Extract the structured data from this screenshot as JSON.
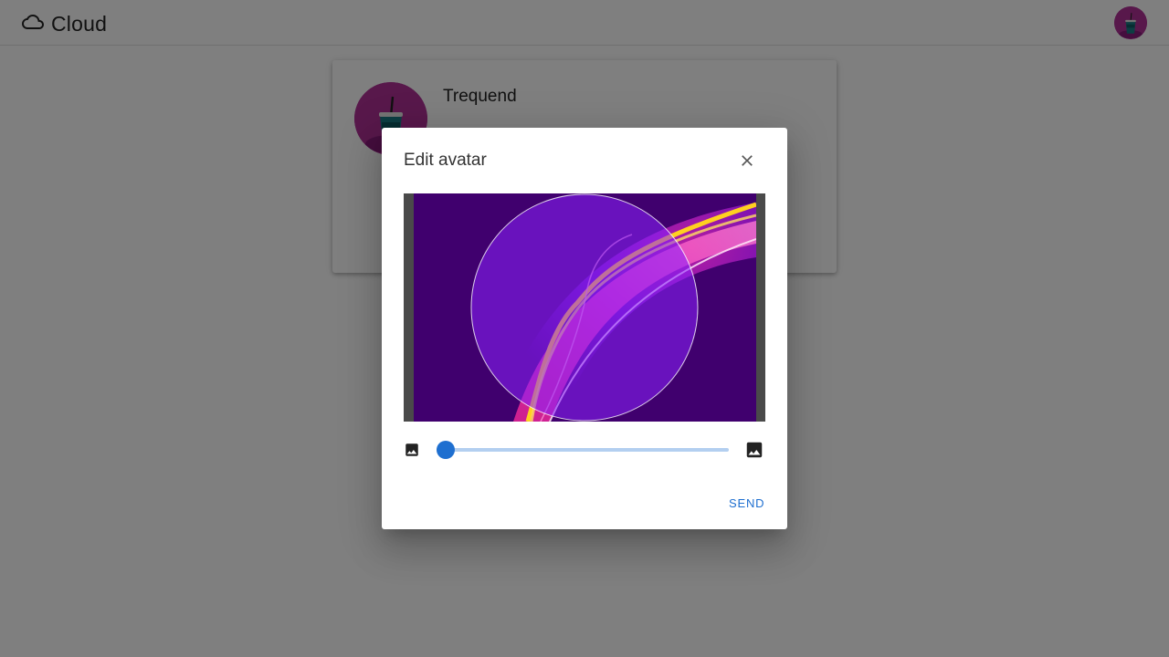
{
  "app": {
    "title": "Cloud",
    "logo_icon": "cloud-outline-icon"
  },
  "profile": {
    "username": "Trequend",
    "avatar_icon": "drink-cup-avatar"
  },
  "dialog": {
    "title": "Edit avatar",
    "close_icon": "close-icon",
    "zoom": {
      "min_icon": "image-small-icon",
      "max_icon": "image-large-icon",
      "value": 0.03
    },
    "send_label": "SEND"
  },
  "colors": {
    "accent": "#1e6fd0",
    "overlay": "rgba(0,0,0,0.5)",
    "avatar_bg": "#a0268f"
  }
}
